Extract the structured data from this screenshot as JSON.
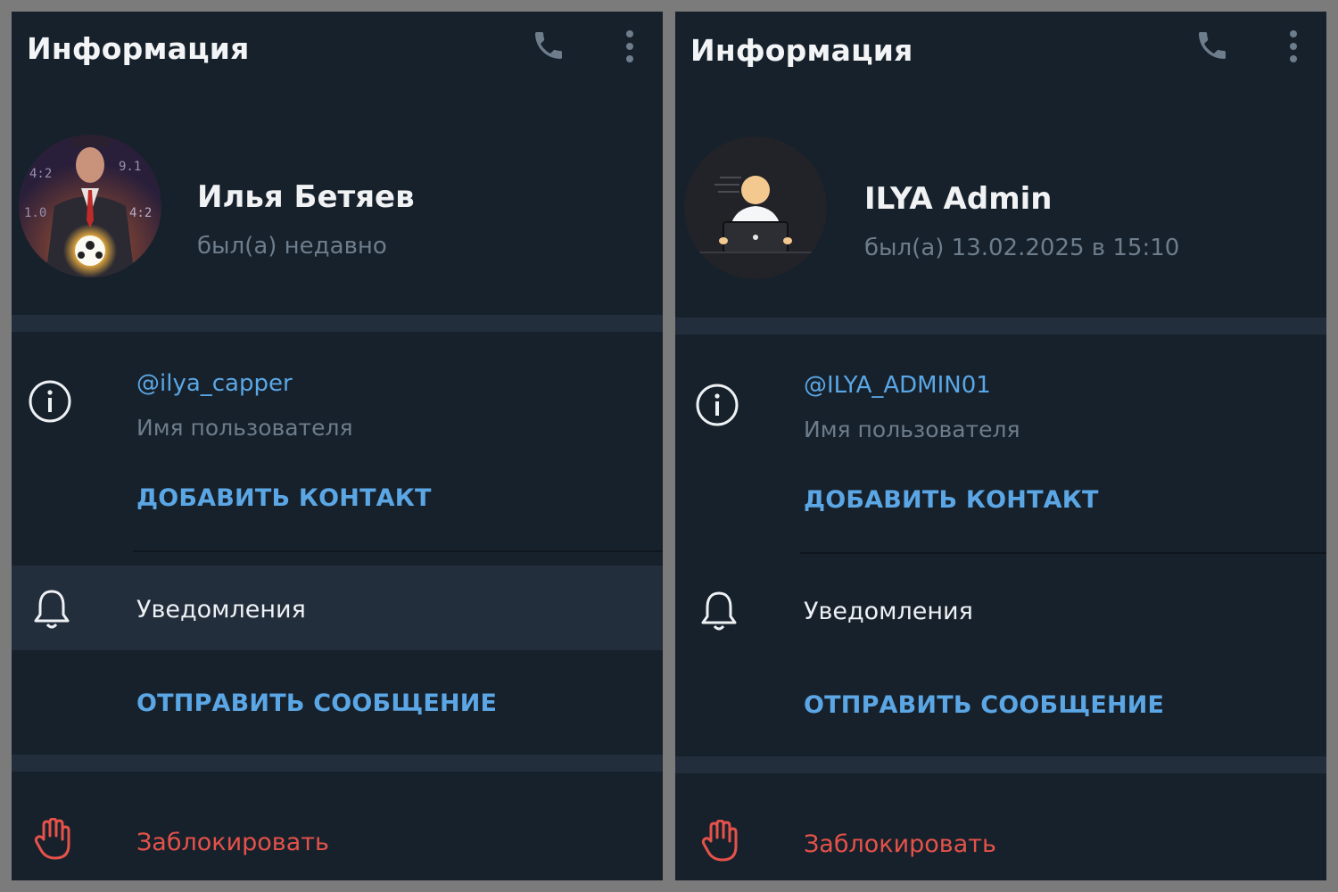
{
  "left_panel": {
    "header": {
      "title": "Информация",
      "icons": [
        "phone-icon",
        "more-vertical-icon"
      ]
    },
    "profile": {
      "name": "Илья Бетяев",
      "status": "был(а) недавно",
      "avatar": "avatar-man-suit-glowing-ball"
    },
    "info": {
      "username": "@ilya_capper",
      "username_label": "Имя пользователя",
      "add_contact": "ДОБАВИТЬ КОНТАКТ"
    },
    "notifications": {
      "label": "Уведомления",
      "highlighted": true
    },
    "send_message": "ОТПРАВИТЬ СООБЩЕНИЕ",
    "block": {
      "label": "Заблокировать"
    }
  },
  "right_panel": {
    "header": {
      "title": "Информация",
      "icons": [
        "phone-icon",
        "more-vertical-icon"
      ]
    },
    "profile": {
      "name": "ILYA Admin",
      "status": "был(а) 13.02.2025 в 15:10",
      "avatar": "avatar-person-laptop"
    },
    "info": {
      "username": "@ILYA_ADMIN01",
      "username_label": "Имя пользователя",
      "add_contact": "ДОБАВИТЬ КОНТАКТ"
    },
    "notifications": {
      "label": "Уведомления",
      "highlighted": false
    },
    "send_message": "ОТПРАВИТЬ СООБЩЕНИЕ",
    "block": {
      "label": "Заблокировать"
    }
  },
  "colors": {
    "background": "#17212b",
    "separator": "#232e3c",
    "accent": "#5ba6e5",
    "muted": "#6d7d8c",
    "danger": "#e5524a"
  }
}
